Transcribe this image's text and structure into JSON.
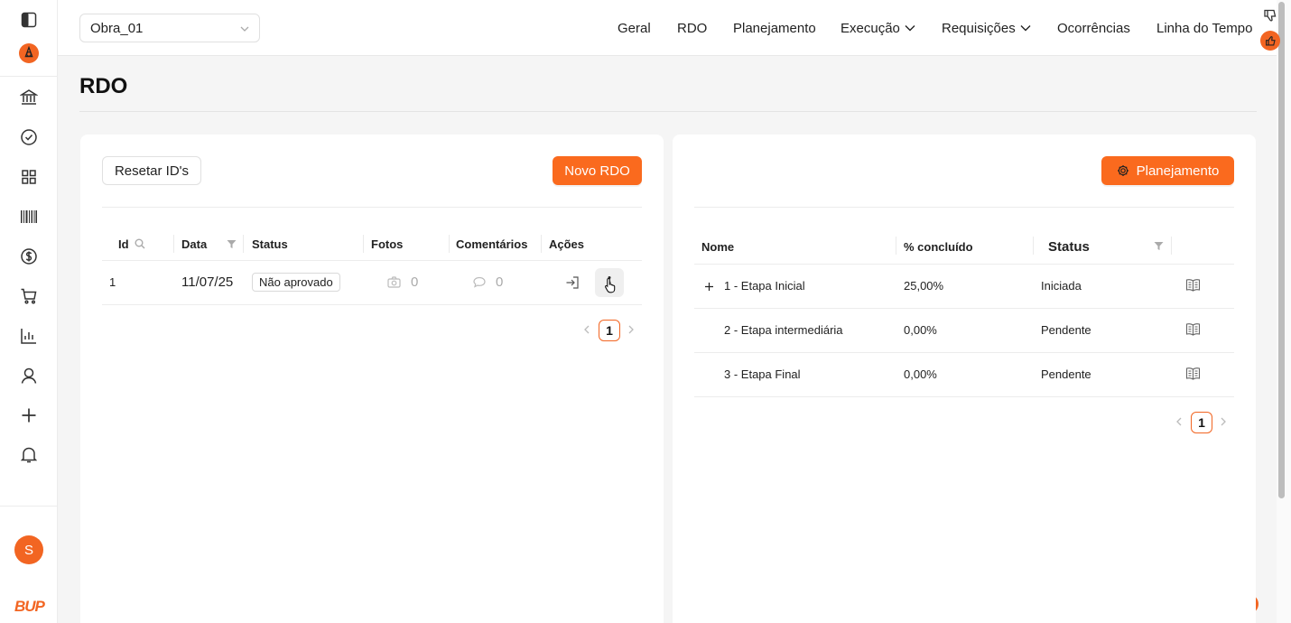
{
  "header": {
    "project_select": "Obra_01",
    "nav": [
      "Geral",
      "RDO",
      "Planejamento",
      "Execução",
      "Requisições",
      "Ocorrências",
      "Linha do Tempo"
    ]
  },
  "sidebar": {
    "avatar_initial": "S",
    "logo_text": "BUP"
  },
  "page": {
    "title": "RDO"
  },
  "left_card": {
    "reset_button": "Resetar ID's",
    "new_button": "Novo RDO",
    "columns": [
      "Id",
      "Data",
      "Status",
      "Fotos",
      "Comentários",
      "Ações"
    ],
    "rows": [
      {
        "id": "1",
        "data": "11/07/25",
        "status": "Não aprovado",
        "fotos": "0",
        "comentarios": "0"
      }
    ],
    "page": "1"
  },
  "right_card": {
    "planning_button": "Planejamento",
    "columns": [
      "Nome",
      "% concluído",
      "Status"
    ],
    "rows": [
      {
        "nome": "1 - Etapa Inicial",
        "percent": "25,00%",
        "status": "Iniciada"
      },
      {
        "nome": "2 - Etapa intermediária",
        "percent": "0,00%",
        "status": "Pendente"
      },
      {
        "nome": "3 - Etapa Final",
        "percent": "0,00%",
        "status": "Pendente"
      }
    ],
    "page": "1"
  },
  "colors": {
    "accent": "#fa6a1e",
    "brand": "#f26522"
  }
}
